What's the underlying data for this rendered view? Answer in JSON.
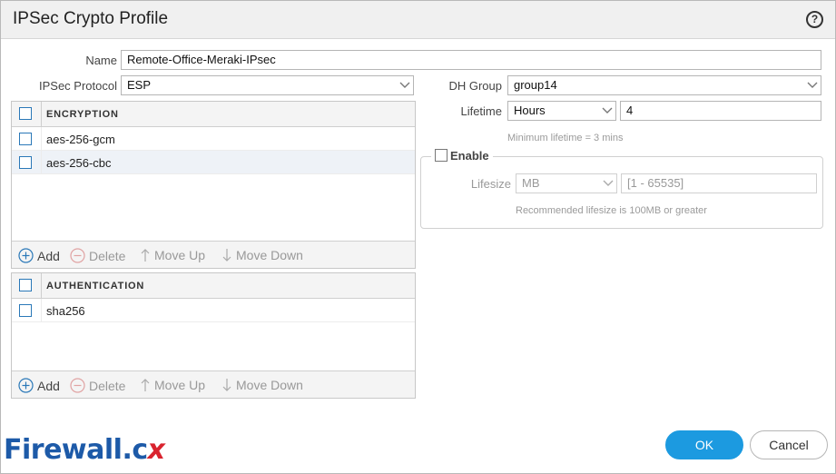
{
  "dialog": {
    "title": "IPSec Crypto Profile",
    "help_glyph": "?"
  },
  "form": {
    "name_label": "Name",
    "name_value": "Remote-Office-Meraki-IPsec",
    "protocol_label": "IPSec Protocol",
    "protocol_value": "ESP",
    "dh_group_label": "DH Group",
    "dh_group_value": "group14",
    "lifetime_label": "Lifetime",
    "lifetime_unit": "Hours",
    "lifetime_value": "4",
    "lifetime_hint": "Minimum lifetime = 3 mins"
  },
  "encryption": {
    "header": "ENCRYPTION",
    "rows": [
      "aes-256-gcm",
      "aes-256-cbc"
    ],
    "selected_row": 1
  },
  "authentication": {
    "header": "AUTHENTICATION",
    "rows": [
      "sha256"
    ]
  },
  "toolbar": {
    "add": "Add",
    "delete": "Delete",
    "move_up": "Move Up",
    "move_down": "Move Down"
  },
  "lifesize": {
    "enable_label": "Enable",
    "enabled": false,
    "label": "Lifesize",
    "unit": "MB",
    "placeholder": "[1 - 65535]",
    "hint": "Recommended lifesize is 100MB or greater"
  },
  "buttons": {
    "ok": "OK",
    "cancel": "Cancel"
  },
  "logo": {
    "text": "Firewall.c",
    "x": "x"
  },
  "colors": {
    "accent": "#1c9ae0",
    "checkbox_border": "#2a78b8",
    "logo_blue": "#1d5aa8",
    "logo_red": "#d9232e"
  }
}
